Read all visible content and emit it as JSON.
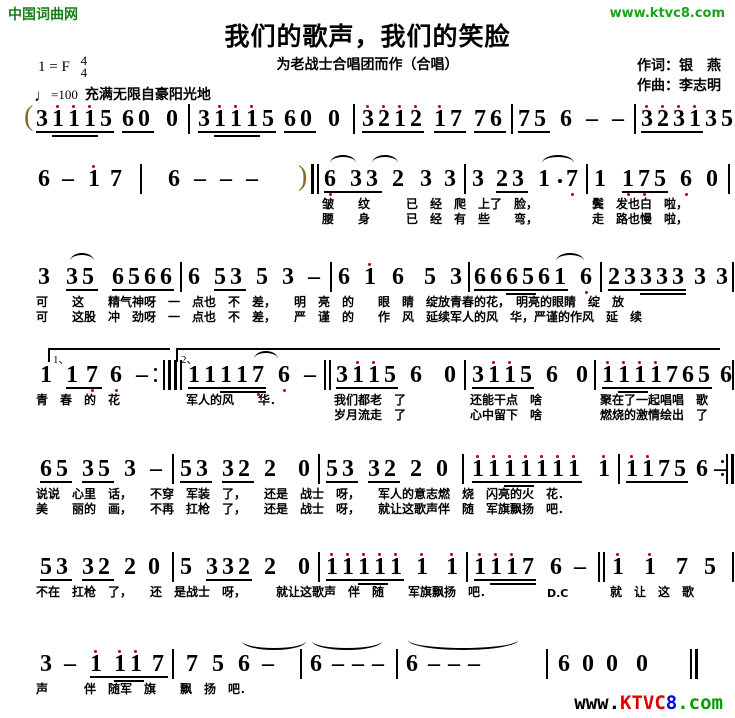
{
  "header": {
    "site_logo": "中国词曲网",
    "site_url": "www.ktvc8.com",
    "title": "我们的歌声，我们的笑脸",
    "subtitle": "为老战士合唱团而作（合唱）",
    "lyricist": "作词：银　燕",
    "composer": "作曲：李志明",
    "key": "1 = F",
    "time_sig_num": "4",
    "time_sig_den": "4",
    "tempo_note": "♩",
    "tempo_value": "=100",
    "expression": "充满无限自豪阳光地"
  },
  "watermark": {
    "w": "www.",
    "r": "KTVC",
    "b": "8",
    "g": ".com"
  },
  "score": {
    "lines": [
      {
        "id": "line-1",
        "notes": "( 3 1̇ 1̇ 1̇ 5  6̲0̲ 0 | 3 1̇ 1̇ 1̇ 5  6̲0̲ 0 | 3̇2̇1̇2̇ 1̇7 76 | 75 6 – – | 3̇2̇3̇1̇ 3 5 |",
        "lyrics_top": "",
        "lyrics_bottom": ""
      },
      {
        "id": "line-2",
        "notes": "6 – 1̇ 7 | 6 – – – ) ‖: 6 33 2 3 3 | 3 23 1·7 | 1 175 6 0 |",
        "lyrics_top": "皱　纹　　已　经　爬　上了　脸，　鬓　发也白　啦，",
        "lyrics_bottom": "腰　身　　已　经　有　些　弯，　　走　路也慢　啦，"
      },
      {
        "id": "line-3",
        "notes": "3 35 6566 | 6 53 5 3 – | 6 1̇ 6 5 3 | 666561 6 | 23333 3 3 |",
        "lyrics_top": "可　这　精气神呀　一　点也　不　差，　明　亮　的　眼　睛　绽放青春的花，　明亮的眼睛　绽　放",
        "lyrics_bottom": "可　这股　冲　劲呀　一　点也　不　差，　严　谨　的　作　风　延续军人的风　华，严谨的作风　延　续"
      },
      {
        "id": "line-4",
        "notes": "[1.] 1 17 6 – :‖ [2.] 11117 6 – ‖ 3 1̇1̇5 6 0 | 3 1̇1̇5 6 0 | 1̇1̇1̇1̇765 6 |",
        "ending1": "1、",
        "ending2": "2、",
        "lyrics_top": "青　春　的　花　　军人的风　华．　我们都老　了　　还能干点　啥　　聚在了一起唱唱　歌",
        "lyrics_bottom": "　　　　　　　　　　　　　　　　岁月流走　了　　心中留下　啥　　燃烧的激情绘出　了"
      },
      {
        "id": "line-5",
        "notes": "65 35 3 – | 53 32 2 0 | 53 32 2 0 | 1̇1̇1̇1̇1̇1̇1̇ 1̇ | 1̇1̇75 6 – :‖",
        "lyrics_top": "说说　心里　话，　不穿　军装　了，　还是　战士　呀，　军人的意志燃　烧　闪亮的火　花．",
        "lyrics_bottom": "美　　丽的　画，　不再　扛枪　了，　还是　战士　呀，　就让这歌声伴　随　军旗飘扬　吧．"
      },
      {
        "id": "line-6",
        "notes": "53 32 2 0 | 5 332 2 0 | 1̇1̇1̇1̇1̇ 1̇ 1̇ | 1̇1̇1̇7 6 – ‖ 1̇ 1̇ 7 5 |",
        "lyrics_top": "不在　扛枪　了，　还　是战士　呀，　　就让这歌声　伴　随　　军旗飘扬　吧．D.C就　让　这　歌",
        "lyrics_bottom": ""
      },
      {
        "id": "line-7",
        "notes": "3 – 1̇ 1̇1̇ 7 | 7 5 6 – | 6 – – – | 6 – – – | 6 0 0 0 ‖",
        "lyrics_top": "声　　伴　随军　旗　飘　扬　吧．",
        "lyrics_bottom": ""
      }
    ]
  },
  "line1": {
    "m1": [
      "3",
      "1",
      "1",
      "1",
      "5",
      "6",
      "0",
      "0"
    ],
    "m2": [
      "3",
      "1",
      "1",
      "1",
      "5",
      "6",
      "0",
      "0"
    ],
    "m3": [
      "3",
      "2",
      "1",
      "2",
      "1",
      "7",
      "7",
      "6"
    ],
    "m4": [
      "7",
      "5",
      "6",
      "–",
      "–"
    ],
    "m5": [
      "3",
      "2",
      "3",
      "1",
      "3",
      "5"
    ]
  },
  "line2": {
    "m1": [
      "6",
      "–",
      "1",
      "7"
    ],
    "m2": [
      "6",
      "–",
      "–",
      "–"
    ],
    "m3": [
      "6",
      "3",
      "3",
      "2",
      "3",
      "3"
    ],
    "m4": [
      "3",
      "2",
      "3",
      "1",
      "·",
      "7"
    ],
    "m5": [
      "1",
      "1",
      "7",
      "5",
      "6",
      "0"
    ],
    "lyr_top": [
      "皱",
      "纹",
      "已",
      "经",
      "爬",
      "上了",
      "脸，",
      "鬓",
      "发也白",
      "啦，"
    ],
    "lyr_bot": [
      "腰",
      "身",
      "已",
      "经",
      "有",
      "些",
      "弯，",
      "走",
      "路也慢",
      "啦，"
    ]
  },
  "line3": {
    "m1": [
      "3",
      "3",
      "5",
      "6",
      "5",
      "6",
      "6"
    ],
    "m2": [
      "6",
      "5",
      "3",
      "5",
      "3",
      "–"
    ],
    "m3": [
      "6",
      "1",
      "6",
      "5",
      "3"
    ],
    "m4": [
      "6",
      "6",
      "6",
      "5",
      "6",
      "1",
      "6"
    ],
    "m5": [
      "2",
      "3",
      "3",
      "3",
      "3",
      "3",
      "3"
    ]
  },
  "line4": {
    "m1": [
      "1",
      "1",
      "7",
      "6",
      "–"
    ],
    "m2": [
      "1",
      "1",
      "1",
      "1",
      "7",
      "6",
      "–"
    ],
    "m3": [
      "3",
      "1",
      "1",
      "5",
      "6",
      "0"
    ],
    "m4": [
      "3",
      "1",
      "1",
      "5",
      "6",
      "0"
    ],
    "m5": [
      "1",
      "1",
      "1",
      "1",
      "7",
      "6",
      "5",
      "6"
    ]
  },
  "line5": {
    "m1": [
      "6",
      "5",
      "3",
      "5",
      "3",
      "–"
    ],
    "m2": [
      "5",
      "3",
      "3",
      "2",
      "2",
      "0"
    ],
    "m3": [
      "5",
      "3",
      "3",
      "2",
      "2",
      "0"
    ],
    "m4": [
      "1",
      "1",
      "1",
      "1",
      "1",
      "1",
      "1",
      "1"
    ],
    "m5": [
      "1",
      "1",
      "7",
      "5",
      "6",
      "–"
    ]
  },
  "line6": {
    "m1": [
      "5",
      "3",
      "3",
      "2",
      "2",
      "0"
    ],
    "m2": [
      "5",
      "3",
      "3",
      "2",
      "2",
      "0"
    ],
    "m3": [
      "1",
      "1",
      "1",
      "1",
      "1",
      "1",
      "1"
    ],
    "m4": [
      "1",
      "1",
      "1",
      "7",
      "6",
      "–"
    ],
    "m5": [
      "1",
      "1",
      "7",
      "5"
    ]
  },
  "line7": {
    "m1": [
      "3",
      "–",
      "1",
      "1",
      "1",
      "7"
    ],
    "m2": [
      "7",
      "5",
      "6",
      "–"
    ],
    "m3": [
      "6",
      "–",
      "–",
      "–"
    ],
    "m4": [
      "6",
      "–",
      "–",
      "–"
    ],
    "m5": [
      "6",
      "0",
      "0",
      "0"
    ]
  },
  "lyrics": {
    "l2_top": "皱纹已经爬上了脸，鬓发也白啦，",
    "l2_bot": "腰身已经有些弯，走路也慢啦，",
    "l3_top": "可这精气神呀一点也不差，明亮的眼睛绽放青春的花，明亮的眼睛绽放",
    "l3_bot": "可这股冲劲呀一点也不差，严谨的作风延续军人的风华，严谨的作风延续",
    "l4_top": "青春的花｜军人的风华。我们都老了还能干点啥聚在了一起唱唱歌",
    "l4_bot": "岁月流走了心中留下啥燃烧的激情绘出了",
    "l5_top": "说说心里话，不穿军装了，还是战士呀，军人的意志燃烧闪亮的火花。",
    "l5_bot": "美丽的画，不再扛枪了，还是战士呀，就让这歌声伴随军旗飘扬吧。",
    "l6_top": "不在扛枪了，还是战士呀，就让这歌声伴随军旗飘扬吧。D.C就让这歌",
    "l7_top": "声伴随军旗飘扬吧。"
  },
  "marks": {
    "ending1": "1、",
    "ending2": "2、",
    "dc": "D.C"
  }
}
